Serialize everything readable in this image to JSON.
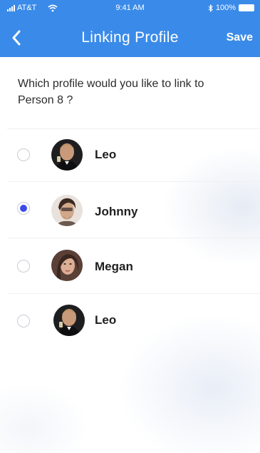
{
  "status_bar": {
    "carrier": "AT&T",
    "time": "9:41 AM",
    "battery": "100%",
    "icons": [
      "signal-icon",
      "wifi-icon",
      "bluetooth-icon",
      "battery-icon"
    ]
  },
  "header": {
    "title": "Linking Profile",
    "save_label": "Save",
    "back_icon": "chevron-left-icon",
    "background_color": "#3a8be9"
  },
  "question": "Which profile would you like to link to Person 8 ?",
  "profiles": [
    {
      "name": "Leo",
      "selected": false
    },
    {
      "name": "Johnny",
      "selected": true
    },
    {
      "name": "Megan",
      "selected": false
    },
    {
      "name": "Leo",
      "selected": false
    }
  ],
  "colors": {
    "accent": "#3a8be9",
    "radio_selected": "#3b4bea",
    "text": "#1f1f1f"
  }
}
